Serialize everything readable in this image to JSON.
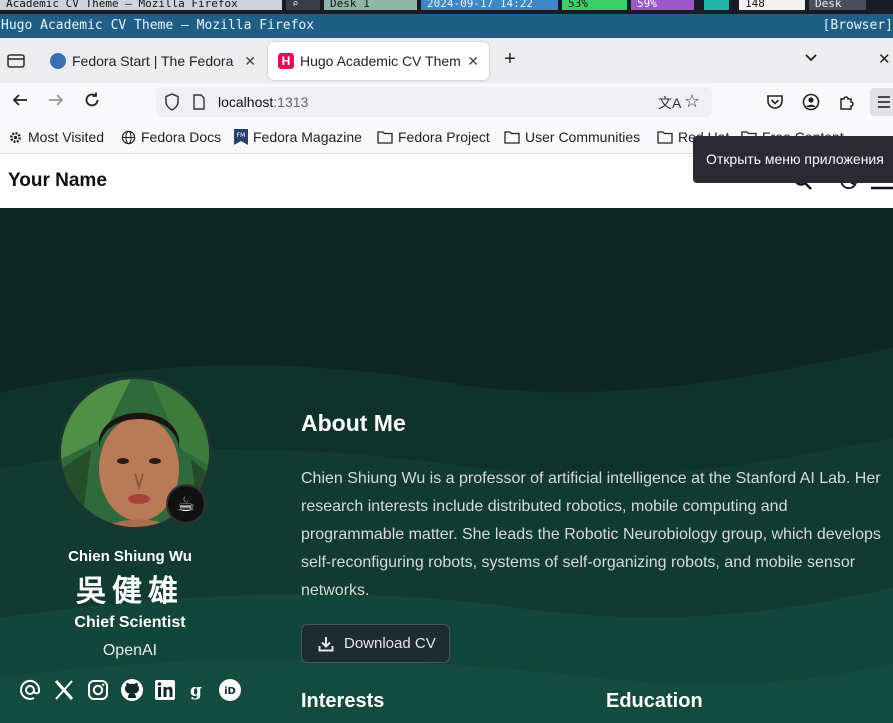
{
  "system_bar": {
    "items": [
      "Academic CV Theme — Mozilla Firefox",
      "",
      "Desk 1",
      "2024-09-17 14:22",
      "53%",
      "59%",
      "",
      "148",
      "Desk"
    ]
  },
  "window": {
    "title": "Hugo Academic CV Theme — Mozilla Firefox",
    "title_right": "[Browser]"
  },
  "tabs": [
    {
      "label": "Fedora Start | The Fedora",
      "active": false
    },
    {
      "label": "Hugo Academic CV Theme",
      "active": true
    }
  ],
  "urlbar": {
    "host": "localhost",
    "port": ":1313"
  },
  "bookmarks": [
    {
      "label": "Most Visited",
      "icon": "gear-icon"
    },
    {
      "label": "Fedora Docs",
      "icon": "globe-icon"
    },
    {
      "label": "Fedora Magazine",
      "icon": "fm-icon"
    },
    {
      "label": "Fedora Project",
      "icon": "folder-icon"
    },
    {
      "label": "User Communities",
      "icon": "folder-icon"
    },
    {
      "label": "Red Hat",
      "icon": "folder-icon"
    },
    {
      "label": "Free Content",
      "icon": "folder-icon"
    }
  ],
  "tooltip": "Открыть меню приложения",
  "site": {
    "brand": "Your Name"
  },
  "profile": {
    "name": "Chien Shiung Wu",
    "name_cjk": "吳健雄",
    "role": "Chief Scientist",
    "organization": "OpenAI",
    "status_emoji": "☕",
    "socials": [
      "email-icon",
      "x-icon",
      "instagram-icon",
      "github-icon",
      "linkedin-icon",
      "google-scholar-icon",
      "orcid-icon"
    ]
  },
  "about": {
    "title": "About Me",
    "text": "Chien Shiung Wu is a professor of artificial intelligence at the Stanford AI Lab. Her research interests include distributed robotics, mobile computing and programmable matter. She leads the Robotic Neurobiology group, which develops self-reconfiguring robots, systems of self-organizing robots, and mobile sensor networks.",
    "cv_button": "Download CV",
    "interests_title": "Interests",
    "education_title": "Education"
  },
  "colors": {
    "hero_bg": "#0e2622",
    "hero_wave": "#134a3c",
    "accent": "#1f5f86"
  }
}
